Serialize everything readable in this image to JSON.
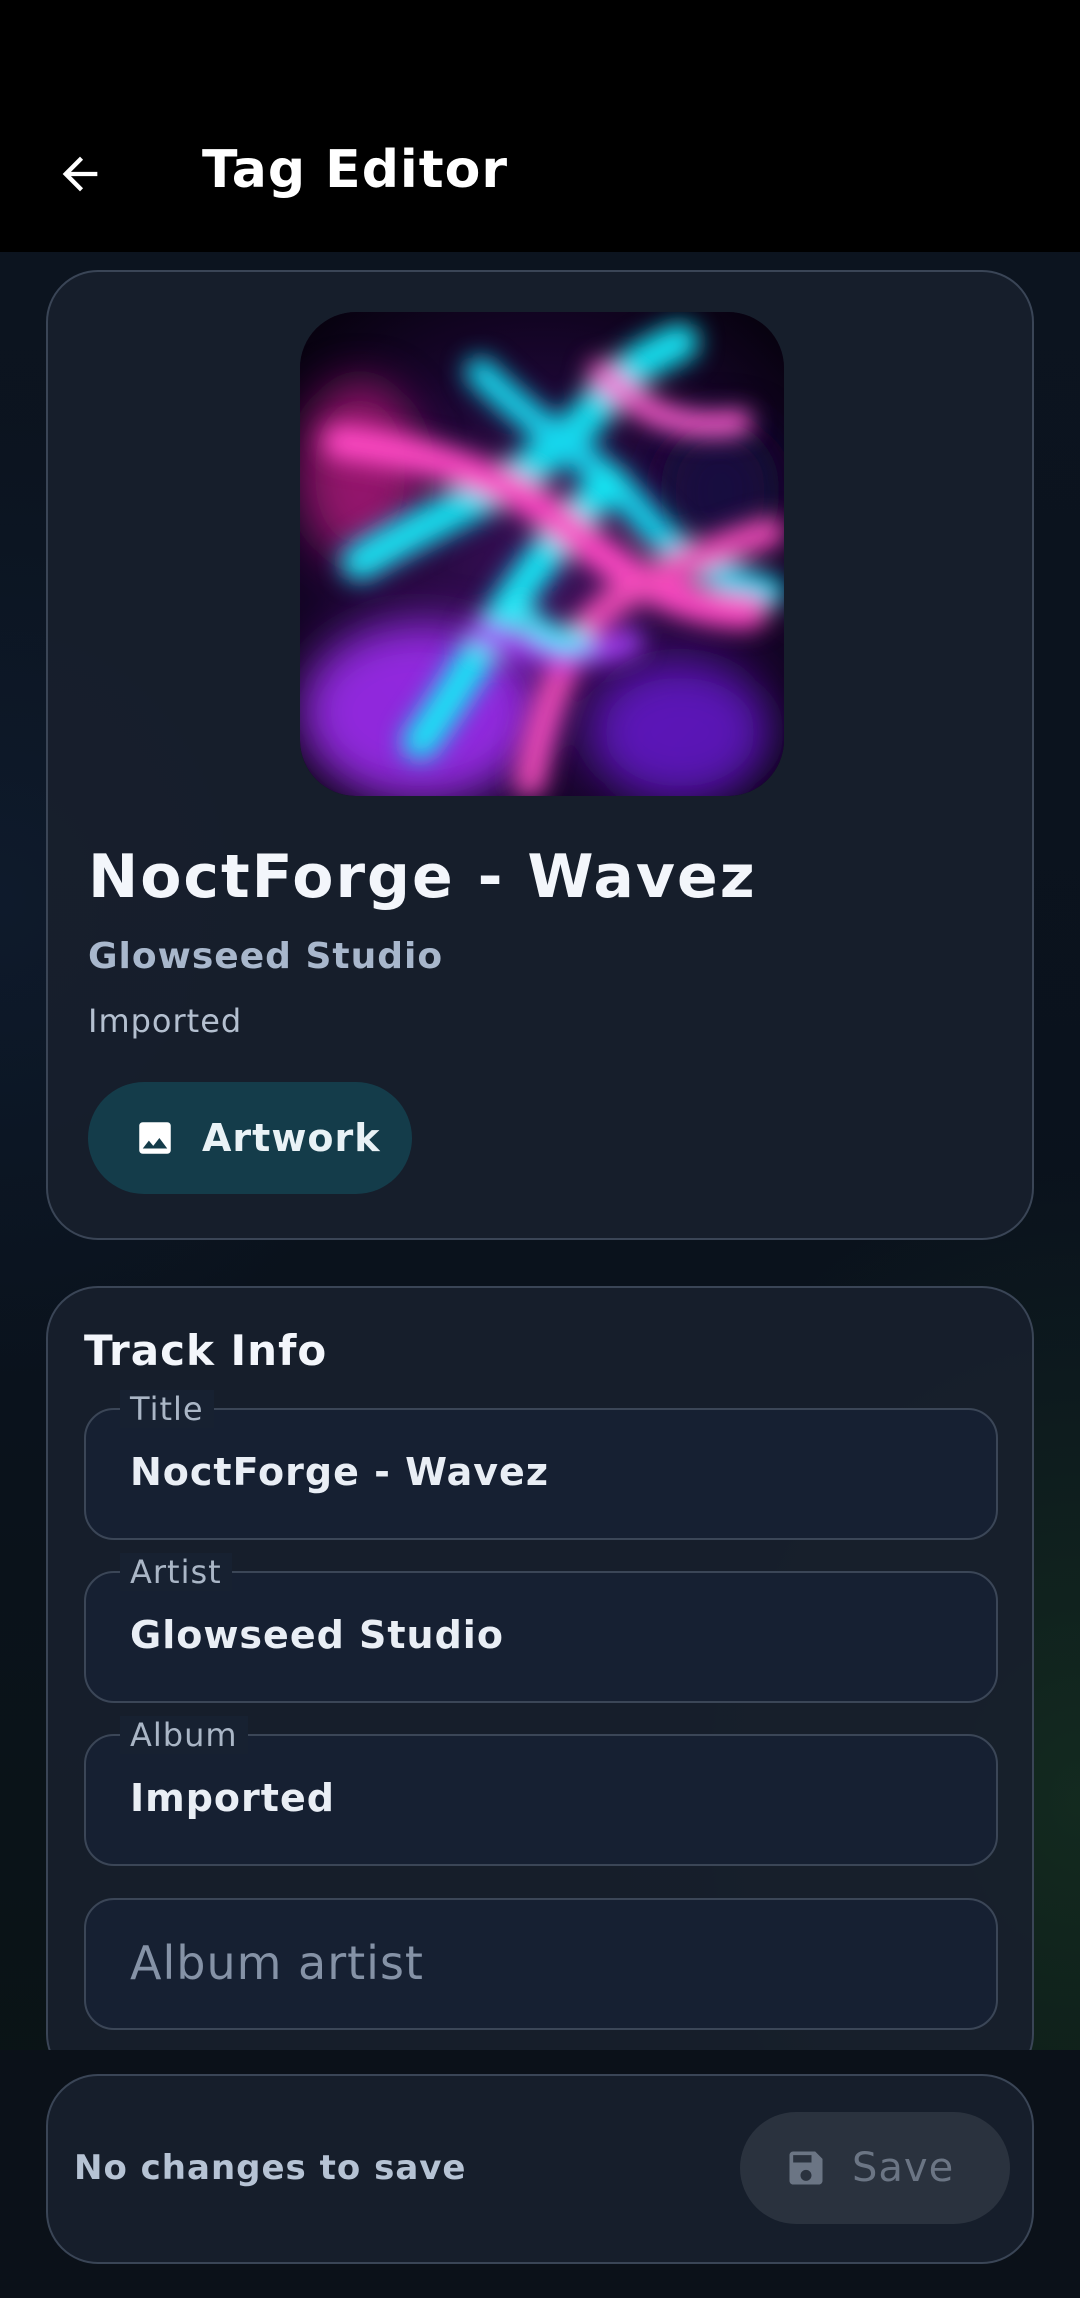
{
  "app_bar": {
    "title": "Tag Editor",
    "back_icon": "arrow-back-icon"
  },
  "header": {
    "artwork_image": "swirl-artwork",
    "title": "NoctForge - Wavez",
    "artist": "Glowseed Studio",
    "album": "Imported",
    "artwork_button": {
      "icon": "image-icon",
      "label": "Artwork"
    }
  },
  "track_info": {
    "heading": "Track Info",
    "fields": [
      {
        "label": "Title",
        "value": "NoctForge - Wavez"
      },
      {
        "label": "Artist",
        "value": "Glowseed Studio"
      },
      {
        "label": "Album",
        "value": "Imported"
      },
      {
        "placeholder": "Album artist"
      }
    ]
  },
  "save_bar": {
    "status": "No changes to save",
    "save_button": {
      "icon": "save-icon",
      "label": "Save",
      "enabled": false
    }
  },
  "colors": {
    "background": "#0a1019",
    "card": "#18202d",
    "accent_button": "#143c4a",
    "disabled_button": "#2a323e"
  }
}
